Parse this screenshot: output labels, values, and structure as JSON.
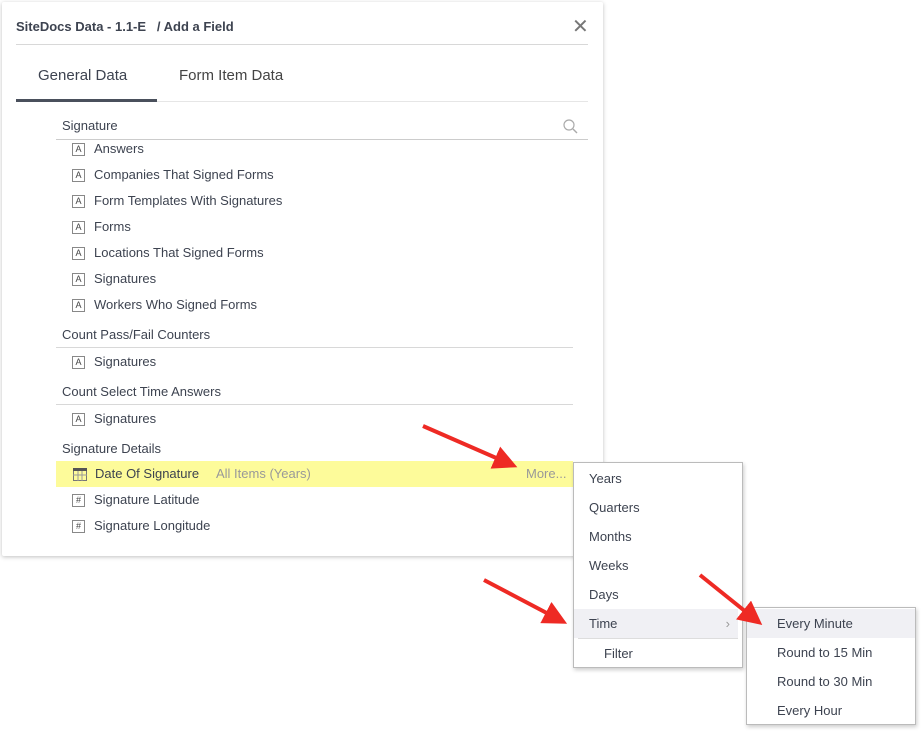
{
  "dialog": {
    "title": "SiteDocs Data - 1.1-E",
    "subtitle": "/ Add a Field",
    "close_icon": "close-icon"
  },
  "tabs": [
    {
      "label": "General Data",
      "active": true
    },
    {
      "label": "Form Item Data",
      "active": false
    }
  ],
  "search": {
    "value": "Signature",
    "icon": "search-icon"
  },
  "groups": [
    {
      "items": [
        "Answers",
        "Companies That Signed Forms",
        "Form Templates With Signatures",
        "Forms",
        "Locations That Signed Forms",
        "Signatures",
        "Workers Who Signed Forms"
      ]
    },
    {
      "header": "Count Pass/Fail Counters",
      "items": [
        "Signatures"
      ]
    },
    {
      "header": "Count Select Time Answers",
      "items": [
        "Signatures"
      ]
    },
    {
      "header": "Signature Details",
      "selected": {
        "label": "Date Of Signature",
        "detail": "All Items (Years)",
        "more": "More..."
      },
      "items": [
        "Signature Latitude",
        "Signature Longitude"
      ]
    }
  ],
  "icons": {
    "text": "A",
    "number": "#"
  },
  "highlight_color": "#fdfb9a",
  "menu": {
    "items": [
      "Years",
      "Quarters",
      "Months",
      "Weeks",
      "Days",
      "Time"
    ],
    "filter": "Filter",
    "submenu_arrow": "›"
  },
  "submenu": {
    "items": [
      "Every Minute",
      "Round to 15 Min",
      "Round to 30 Min",
      "Every Hour"
    ]
  },
  "annotation_color": "#ee2a24"
}
